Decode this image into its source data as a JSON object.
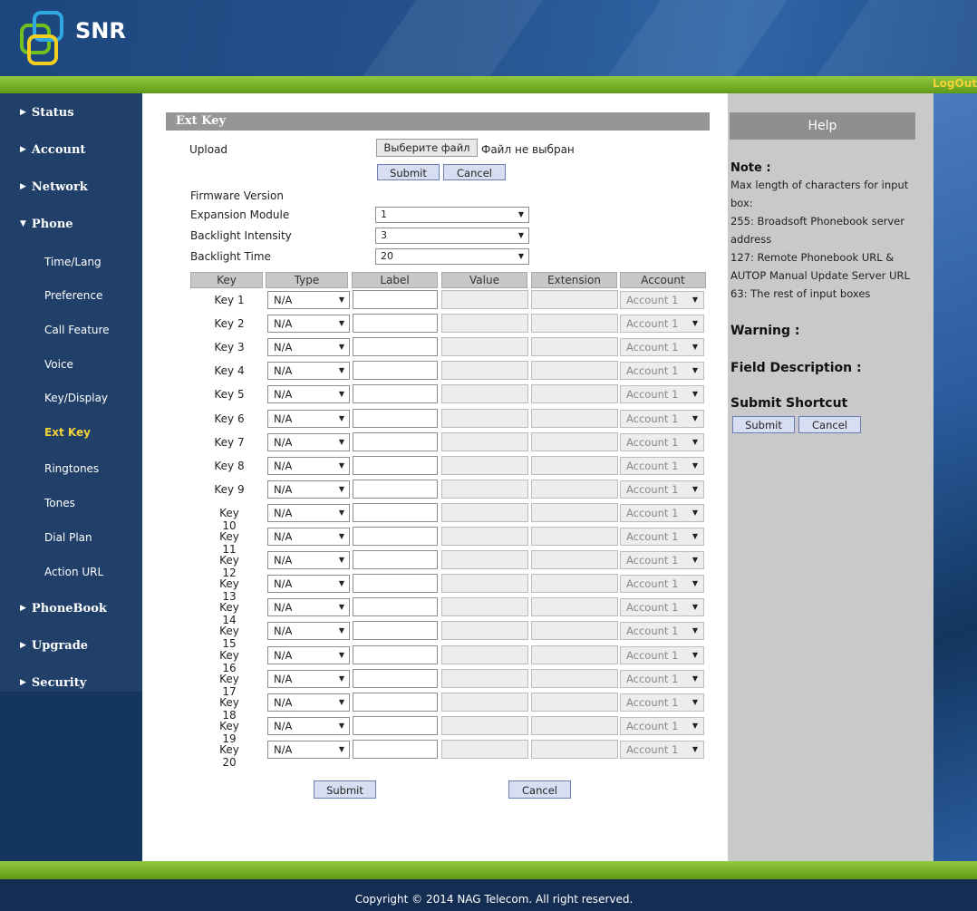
{
  "logo": {
    "text": "SNR"
  },
  "logout": "LogOut",
  "sidebar": {
    "items": [
      {
        "label": "Status",
        "type": "top",
        "expanded": false
      },
      {
        "label": "Account",
        "type": "top",
        "expanded": false
      },
      {
        "label": "Network",
        "type": "top",
        "expanded": false
      },
      {
        "label": "Phone",
        "type": "top",
        "expanded": true
      },
      {
        "label": "Time/Lang",
        "type": "sub"
      },
      {
        "label": "Preference",
        "type": "sub"
      },
      {
        "label": "Call Feature",
        "type": "sub"
      },
      {
        "label": "Voice",
        "type": "sub"
      },
      {
        "label": "Key/Display",
        "type": "sub"
      },
      {
        "label": "Ext Key",
        "type": "sub",
        "active": true
      },
      {
        "label": "Ringtones",
        "type": "sub"
      },
      {
        "label": "Tones",
        "type": "sub"
      },
      {
        "label": "Dial Plan",
        "type": "sub"
      },
      {
        "label": "Action URL",
        "type": "sub"
      },
      {
        "label": "PhoneBook",
        "type": "top",
        "expanded": false
      },
      {
        "label": "Upgrade",
        "type": "top",
        "expanded": false
      },
      {
        "label": "Security",
        "type": "top",
        "expanded": false
      }
    ]
  },
  "main": {
    "title": "Ext Key",
    "upload": {
      "label": "Upload",
      "file_button": "Выберите файл",
      "file_status": "Файл не выбран",
      "submit": "Submit",
      "cancel": "Cancel"
    },
    "firmware_label": "Firmware Version",
    "expansion_module": {
      "label": "Expansion Module",
      "value": "1"
    },
    "backlight_intensity": {
      "label": "Backlight Intensity",
      "value": "3"
    },
    "backlight_time": {
      "label": "Backlight Time",
      "value": "20"
    },
    "table": {
      "headers": [
        "Key",
        "Type",
        "Label",
        "Value",
        "Extension",
        "Account"
      ],
      "rows": [
        {
          "key": "Key 1",
          "type": "N/A",
          "account": "Account 1"
        },
        {
          "key": "Key 2",
          "type": "N/A",
          "account": "Account 1"
        },
        {
          "key": "Key 3",
          "type": "N/A",
          "account": "Account 1"
        },
        {
          "key": "Key 4",
          "type": "N/A",
          "account": "Account 1"
        },
        {
          "key": "Key 5",
          "type": "N/A",
          "account": "Account 1"
        },
        {
          "key": "Key 6",
          "type": "N/A",
          "account": "Account 1"
        },
        {
          "key": "Key 7",
          "type": "N/A",
          "account": "Account 1"
        },
        {
          "key": "Key 8",
          "type": "N/A",
          "account": "Account 1"
        },
        {
          "key": "Key 9",
          "type": "N/A",
          "account": "Account 1"
        },
        {
          "key": "Key 10",
          "type": "N/A",
          "account": "Account 1"
        },
        {
          "key": "Key 11",
          "type": "N/A",
          "account": "Account 1"
        },
        {
          "key": "Key 12",
          "type": "N/A",
          "account": "Account 1"
        },
        {
          "key": "Key 13",
          "type": "N/A",
          "account": "Account 1"
        },
        {
          "key": "Key 14",
          "type": "N/A",
          "account": "Account 1"
        },
        {
          "key": "Key 15",
          "type": "N/A",
          "account": "Account 1"
        },
        {
          "key": "Key 16",
          "type": "N/A",
          "account": "Account 1"
        },
        {
          "key": "Key 17",
          "type": "N/A",
          "account": "Account 1"
        },
        {
          "key": "Key 18",
          "type": "N/A",
          "account": "Account 1"
        },
        {
          "key": "Key 19",
          "type": "N/A",
          "account": "Account 1"
        },
        {
          "key": "Key 20",
          "type": "N/A",
          "account": "Account 1"
        }
      ]
    },
    "submit": "Submit",
    "cancel": "Cancel"
  },
  "help": {
    "title": "Help",
    "note_heading": "Note :",
    "note_lines": [
      "Max length of characters for input box:",
      "255: Broadsoft Phonebook server address",
      "127: Remote Phonebook URL & AUTOP Manual Update Server URL",
      "63: The rest of input boxes"
    ],
    "warning_heading": "Warning :",
    "field_description_heading": "Field Description :",
    "submit_shortcut_heading": "Submit Shortcut",
    "submit": "Submit",
    "cancel": "Cancel"
  },
  "footer": {
    "copyright": "Copyright © 2014 NAG Telecom. All right reserved."
  },
  "colors": {
    "header_blue": "#25528d",
    "sidebar_blue": "#203f69",
    "green_bar": "#7bb52a",
    "active_nav": "#f3d33a",
    "panel_grey": "#969696",
    "help_grey": "#c9c9c9",
    "button_fill": "#d8def2"
  },
  "icons": {
    "nav_arrow": "triangle-right-icon",
    "nav_arrow_open": "triangle-down-icon",
    "select_caret": "caret-down-icon"
  }
}
